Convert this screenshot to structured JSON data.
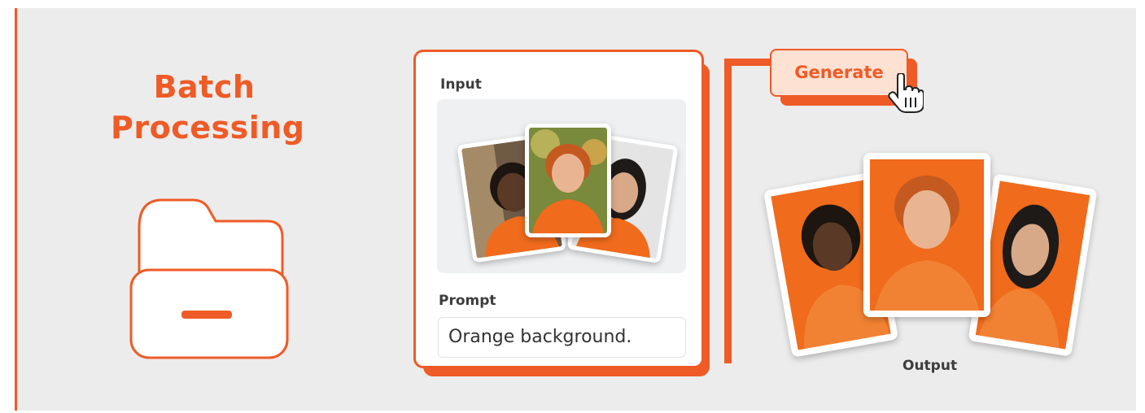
{
  "title": {
    "line1": "Batch",
    "line2": "Processing"
  },
  "input_panel": {
    "input_label": "Input",
    "prompt_label": "Prompt",
    "prompt_value": "Orange background."
  },
  "generate_button": {
    "label": "Generate"
  },
  "output": {
    "label": "Output"
  },
  "icons": {
    "folder": "folder-icon",
    "cursor": "hand-pointer-icon"
  },
  "colors": {
    "accent": "#ef5b27",
    "button_fill": "#fde1d2",
    "background": "#ececec",
    "orange_bg": "#f06b1c"
  }
}
